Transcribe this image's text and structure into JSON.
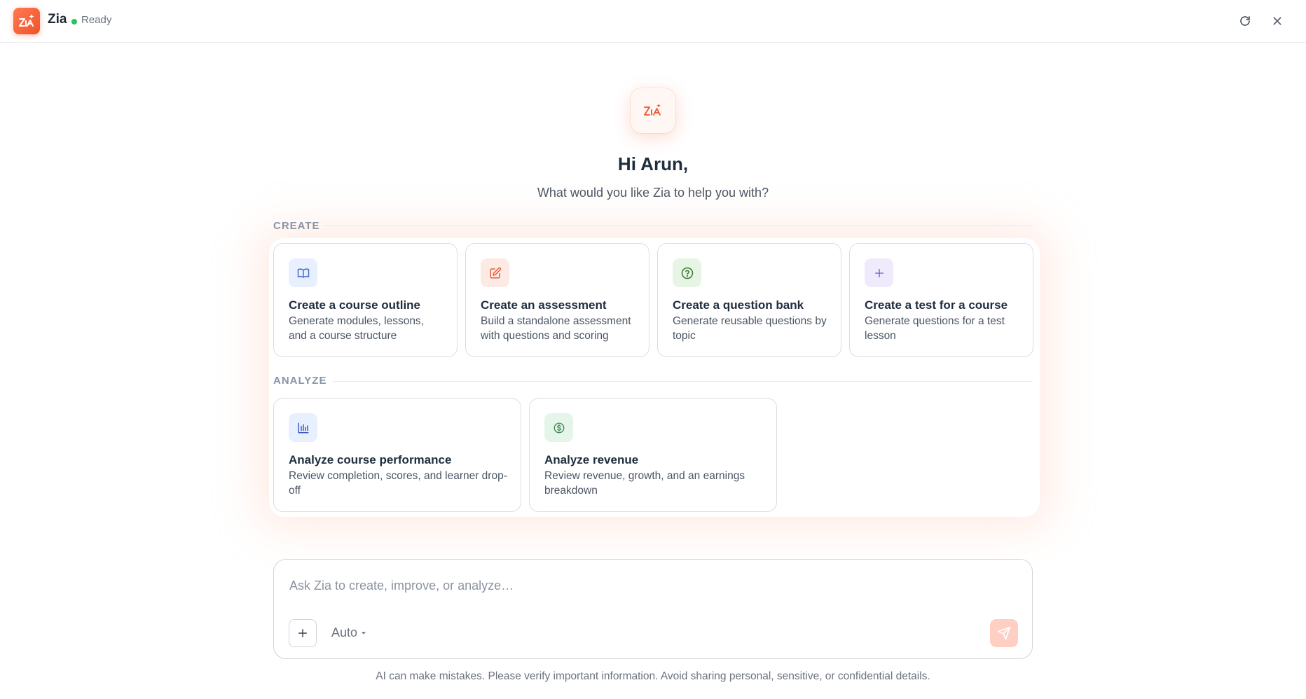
{
  "header": {
    "app_name": "Zia",
    "status": "Ready",
    "status_color": "#22c55e",
    "actions": [
      "refresh-icon",
      "close-icon"
    ]
  },
  "hero": {
    "greeting": "Hi Arun,",
    "subtitle": "What would you like Zia to help you with?"
  },
  "sections": {
    "create": {
      "label": "CREATE",
      "cards": [
        {
          "icon": "book-open-icon",
          "icon_bg": "#e8efff",
          "icon_color": "#4a6fd1",
          "title": "Create a course outline",
          "description": "Generate modules, lessons, and a course structure"
        },
        {
          "icon": "edit-icon",
          "icon_bg": "#fdeae4",
          "icon_color": "#e8603c",
          "title": "Create an assessment",
          "description": "Build a standalone assessment with questions and scoring"
        },
        {
          "icon": "question-circle-icon",
          "icon_bg": "#e6f5e4",
          "icon_color": "#3d7a33",
          "title": "Create a question bank",
          "description": "Generate reusable questions by topic"
        },
        {
          "icon": "plus-icon",
          "icon_bg": "#efebfc",
          "icon_color": "#6b5bd6",
          "title": "Create a test for a course",
          "description": "Generate questions for a test lesson"
        }
      ]
    },
    "analyze": {
      "label": "ANALYZE",
      "cards": [
        {
          "icon": "bar-chart-icon",
          "icon_bg": "#e8efff",
          "icon_color": "#3b5bc4",
          "title": "Analyze course performance",
          "description": "Review completion, scores, and learner drop-off"
        },
        {
          "icon": "dollar-circle-icon",
          "icon_bg": "#e6f5ea",
          "icon_color": "#3d8a55",
          "title": "Analyze revenue",
          "description": "Review revenue, growth, and an earnings breakdown"
        }
      ]
    }
  },
  "composer": {
    "placeholder": "Ask Zia to create, improve, or analyze…",
    "value": "",
    "model": "Auto"
  },
  "disclaimer": "AI can make mistakes. Please verify important information. Avoid sharing personal, sensitive, or confidential details.",
  "colors": {
    "brand": "#f0532b",
    "send_button": "#fecfc2"
  }
}
